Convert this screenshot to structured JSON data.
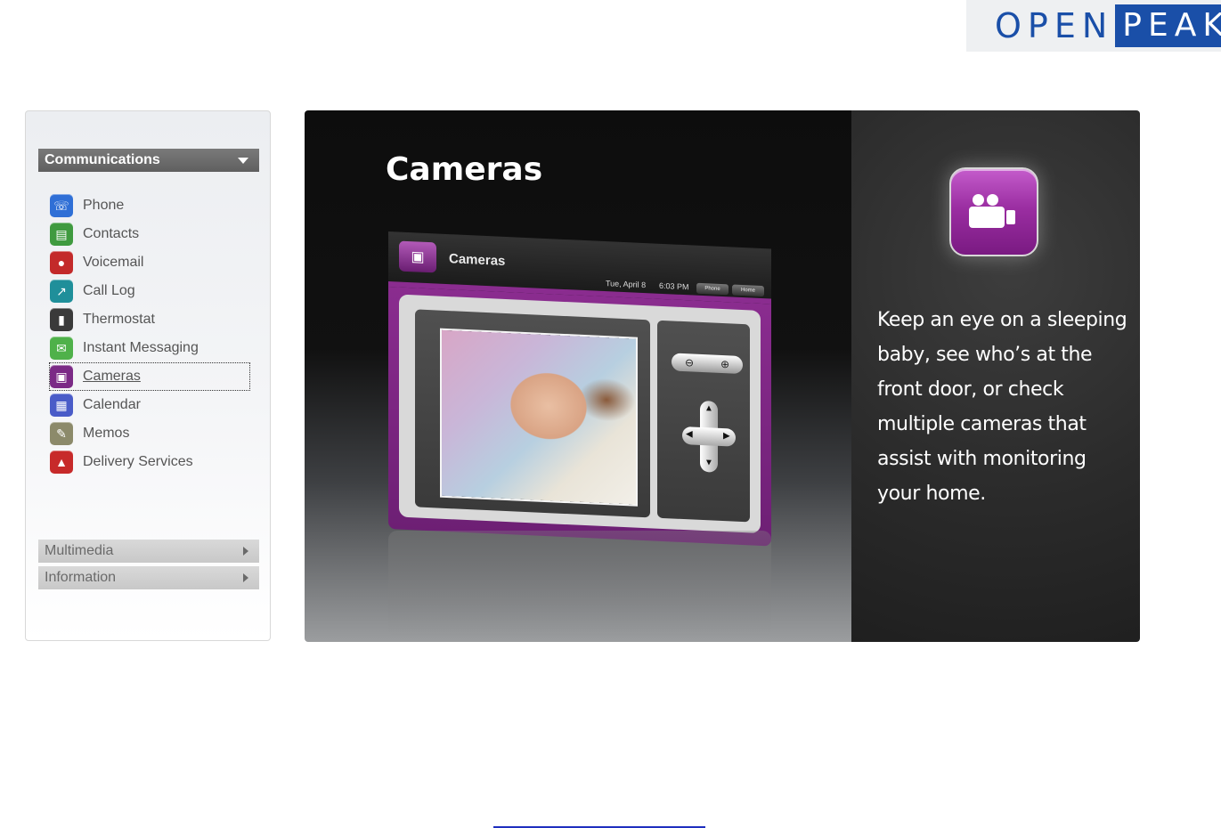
{
  "brand": {
    "open": "OPEN",
    "peak": "PEAK"
  },
  "sidebar": {
    "active_section": "Communications",
    "items": [
      {
        "label": "Phone",
        "icon": "phone-icon",
        "color": "#2f6fd6",
        "glyph": "☏"
      },
      {
        "label": "Contacts",
        "icon": "contacts-icon",
        "color": "#3f9a3f",
        "glyph": "▤"
      },
      {
        "label": "Voicemail",
        "icon": "voicemail-icon",
        "color": "#c32a2a",
        "glyph": "●"
      },
      {
        "label": "Call Log",
        "icon": "call-log-icon",
        "color": "#1f8f9a",
        "glyph": "↗"
      },
      {
        "label": "Thermostat",
        "icon": "thermostat-icon",
        "color": "#3a3a3a",
        "glyph": "▮"
      },
      {
        "label": "Instant Messaging",
        "icon": "instant-messaging-icon",
        "color": "#4fb14a",
        "glyph": "✉"
      },
      {
        "label": "Cameras",
        "icon": "cameras-icon",
        "color": "#7b2a86",
        "glyph": "▣",
        "selected": true
      },
      {
        "label": "Calendar",
        "icon": "calendar-icon",
        "color": "#4a5cc8",
        "glyph": "▦"
      },
      {
        "label": "Memos",
        "icon": "memos-icon",
        "color": "#8c8a6a",
        "glyph": "✎"
      },
      {
        "label": "Delivery Services",
        "icon": "delivery-services-icon",
        "color": "#c72a2a",
        "glyph": "▲"
      }
    ],
    "collapsed_sections": [
      "Multimedia",
      "Information"
    ]
  },
  "feature": {
    "title": "Cameras",
    "device": {
      "title": "Cameras",
      "date": "Tue, April 8",
      "time": "6:03 PM",
      "buttons": [
        "Phone",
        "Home"
      ]
    },
    "description": "Keep an eye on a sleeping baby, see who’s at the front door, or check multiple cameras that assist with monitoring your home."
  },
  "colors": {
    "accent_purple": "#8a2c8f",
    "brand_blue": "#1a4fa8"
  }
}
